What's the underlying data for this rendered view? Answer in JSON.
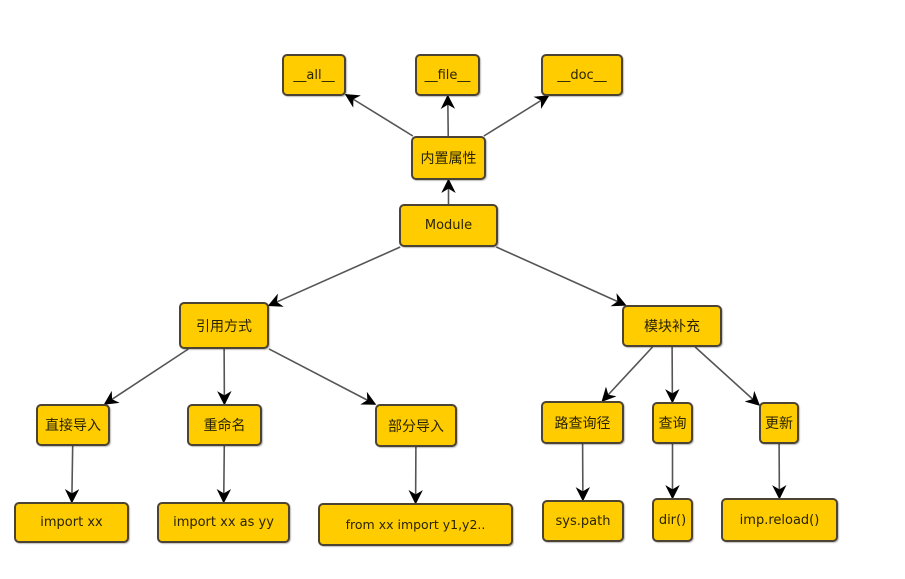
{
  "diagram": {
    "type": "tree",
    "colors": {
      "node_fill": "#ffcc00",
      "node_border": "#4d4332",
      "edge": "#555555",
      "arrowhead": "#000000"
    },
    "nodes": {
      "all": "__all__",
      "file": "__file__",
      "doc": "__doc__",
      "builtin_attrs": "内置属性",
      "module": "Module",
      "ref_ways": "引用方式",
      "module_extra": "模块补充",
      "direct_import": "直接导入",
      "rename": "重命名",
      "partial_import": "部分导入",
      "path_query": "路查询径",
      "query": "查询",
      "update": "更新",
      "import_xx": "import xx",
      "import_as": "import xx as yy",
      "from_import": "from xx import y1,y2..",
      "sys_path": "sys.path",
      "dir": "dir()",
      "reload": "imp.reload()"
    },
    "edges": [
      [
        "builtin_attrs",
        "all"
      ],
      [
        "builtin_attrs",
        "file"
      ],
      [
        "builtin_attrs",
        "doc"
      ],
      [
        "module",
        "builtin_attrs"
      ],
      [
        "module",
        "ref_ways"
      ],
      [
        "module",
        "module_extra"
      ],
      [
        "ref_ways",
        "direct_import"
      ],
      [
        "ref_ways",
        "rename"
      ],
      [
        "ref_ways",
        "partial_import"
      ],
      [
        "module_extra",
        "path_query"
      ],
      [
        "module_extra",
        "query"
      ],
      [
        "module_extra",
        "update"
      ],
      [
        "direct_import",
        "import_xx"
      ],
      [
        "rename",
        "import_as"
      ],
      [
        "partial_import",
        "from_import"
      ],
      [
        "path_query",
        "sys_path"
      ],
      [
        "query",
        "dir"
      ],
      [
        "update",
        "reload"
      ]
    ]
  }
}
